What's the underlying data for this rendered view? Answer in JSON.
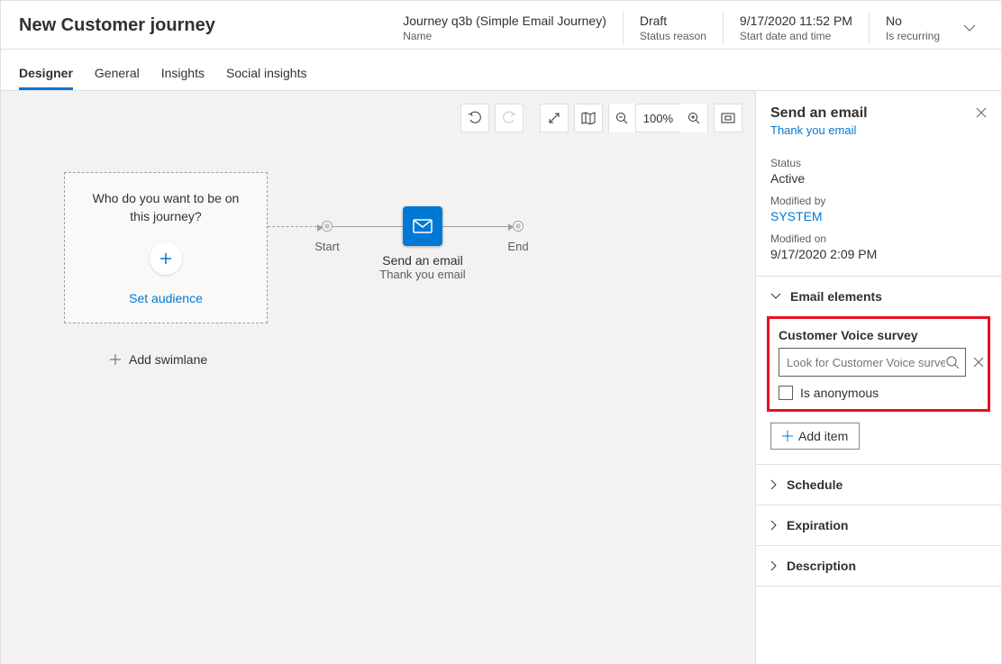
{
  "header": {
    "title": "New Customer journey",
    "fields": [
      {
        "value": "Journey q3b (Simple Email Journey)",
        "label": "Name"
      },
      {
        "value": "Draft",
        "label": "Status reason"
      },
      {
        "value": "9/17/2020 11:52 PM",
        "label": "Start date and time"
      },
      {
        "value": "No",
        "label": "Is recurring"
      }
    ]
  },
  "tabs": [
    "Designer",
    "General",
    "Insights",
    "Social insights"
  ],
  "toolbar": {
    "zoom": "100%"
  },
  "canvas": {
    "audience": {
      "question": "Who do you want to be on this journey?",
      "action": "Set audience"
    },
    "start_label": "Start",
    "end_label": "End",
    "tile": {
      "title": "Send an email",
      "subtitle": "Thank you email"
    },
    "add_swimlane": "Add swimlane"
  },
  "panel": {
    "title": "Send an email",
    "subtitle": "Thank you email",
    "meta": {
      "status_label": "Status",
      "status_value": "Active",
      "modified_by_label": "Modified by",
      "modified_by_value": "SYSTEM",
      "modified_on_label": "Modified on",
      "modified_on_value": "9/17/2020 2:09 PM"
    },
    "sections": {
      "email_elements": "Email elements",
      "schedule": "Schedule",
      "expiration": "Expiration",
      "description": "Description"
    },
    "survey": {
      "label": "Customer Voice survey",
      "placeholder": "Look for Customer Voice survey",
      "anon": "Is anonymous"
    },
    "add_item": "Add item"
  }
}
